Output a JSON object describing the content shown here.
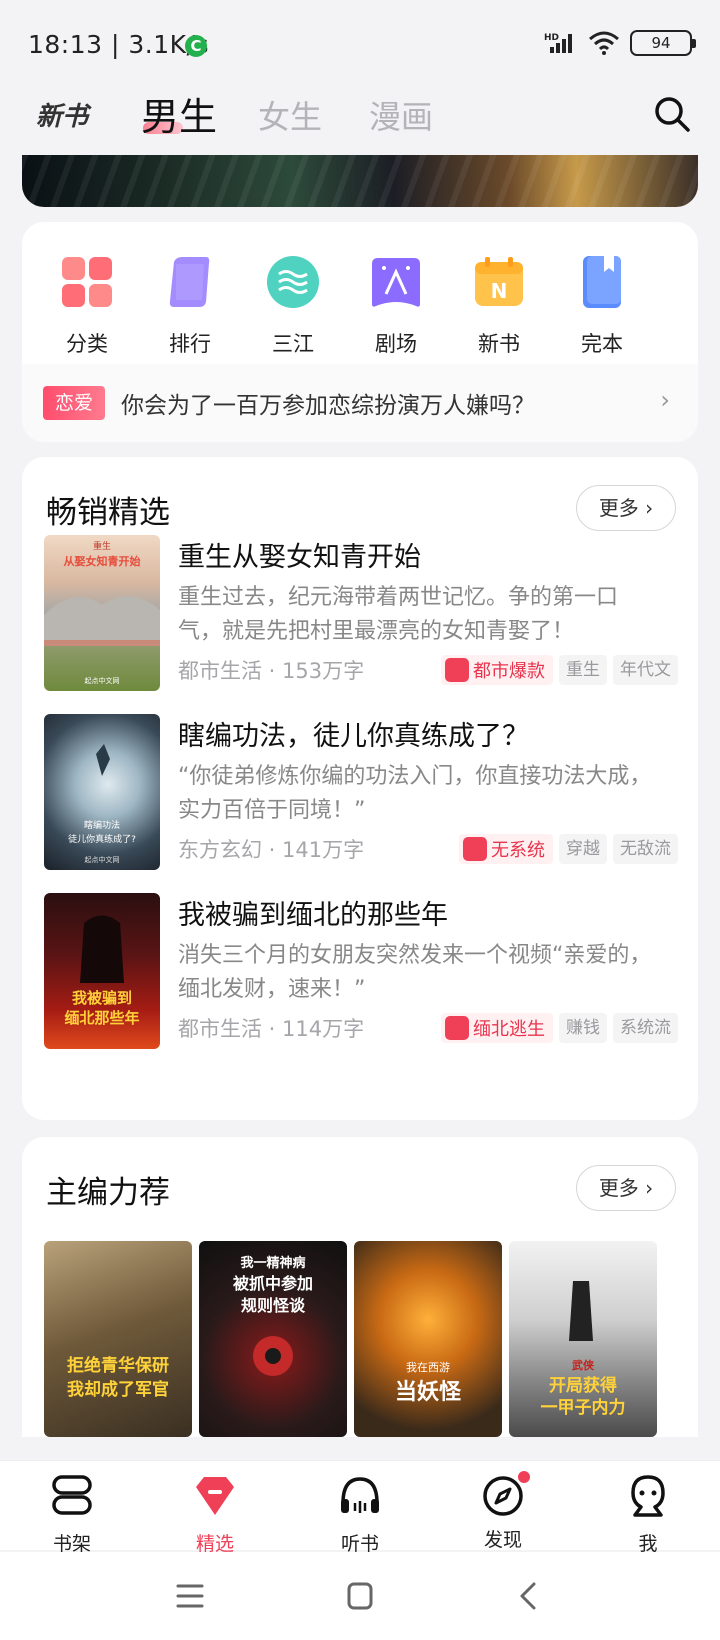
{
  "status_bar": {
    "time": "18:13 | 3.1K/s",
    "app_badge": "C",
    "network": "HD",
    "battery": "94"
  },
  "top_nav": {
    "tabs": [
      {
        "label": "新书"
      },
      {
        "label": "男生",
        "active": true
      },
      {
        "label": "女生"
      },
      {
        "label": "漫画"
      }
    ]
  },
  "quick_entries": [
    {
      "label": "分类",
      "icon": "category-icon"
    },
    {
      "label": "排行",
      "icon": "rank-icon"
    },
    {
      "label": "三江",
      "icon": "sanjiang-icon"
    },
    {
      "label": "剧场",
      "icon": "theater-icon"
    },
    {
      "label": "新书",
      "icon": "new-book-icon"
    },
    {
      "label": "完本",
      "icon": "finished-icon"
    }
  ],
  "promo": {
    "tag": "恋爱",
    "text": "你会为了一百万参加恋综扮演万人嫌吗？"
  },
  "bestseller": {
    "title": "畅销精选",
    "more": "更多",
    "books": [
      {
        "title": "重生从娶女知青开始",
        "desc": "重生过去，纪元海带着两世记忆。争的第一口气，就是先把村里最漂亮的女知青娶了！",
        "genre": "都市生活",
        "words": "153万字",
        "main_tag": "都市爆款",
        "tags": [
          "重生",
          "年代文"
        ]
      },
      {
        "title": "瞎编功法，徒儿你真练成了？",
        "desc": "“你徒弟修炼你编的功法入门，你直接功法大成，实力百倍于同境！”",
        "genre": "东方玄幻",
        "words": "141万字",
        "main_tag": "无系统",
        "tags": [
          "穿越",
          "无敌流"
        ]
      },
      {
        "title": "我被骗到缅北的那些年",
        "desc": "消失三个月的女朋友突然发来一个视频“亲爱的，缅北发财，速来！”",
        "genre": "都市生活",
        "words": "114万字",
        "main_tag": "缅北逃生",
        "tags": [
          "赚钱",
          "系统流"
        ]
      }
    ]
  },
  "editor_picks": {
    "title": "主编力荐",
    "more": "更多",
    "books": [
      {
        "cover_text": "拒绝青华保研我却成了军官",
        "title_partial": "拒绝青华保"
      },
      {
        "cover_text": "我一精神病被抓中参加规则怪谈",
        "title_partial": "我一精神"
      },
      {
        "cover_text": "我在西游当妖怪",
        "title_partial": "我在西游当"
      },
      {
        "cover_text": "武侠开局获得一甲子内力",
        "title_partial": "武侠：开局"
      }
    ]
  },
  "tab_bar": [
    {
      "label": "书架",
      "icon": "bookshelf-icon"
    },
    {
      "label": "精选",
      "icon": "featured-icon",
      "active": true
    },
    {
      "label": "听书",
      "icon": "headphones-icon"
    },
    {
      "label": "发现",
      "icon": "compass-icon",
      "badge": true
    },
    {
      "label": "我",
      "icon": "profile-icon"
    }
  ],
  "colors": {
    "accent": "#ef4058",
    "background": "#f3f3f5"
  }
}
